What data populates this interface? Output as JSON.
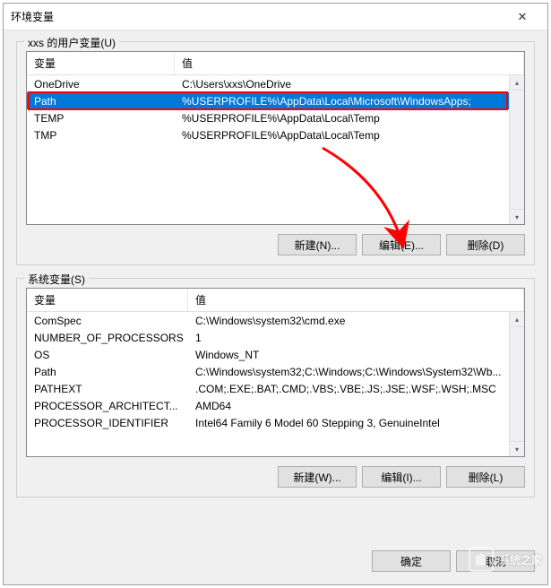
{
  "title": "环境变量",
  "userVars": {
    "label": "xxs 的用户变量(U)",
    "headers": {
      "name": "变量",
      "value": "值"
    },
    "rows": [
      {
        "name": "OneDrive",
        "value": "C:\\Users\\xxs\\OneDrive"
      },
      {
        "name": "Path",
        "value": "%USERPROFILE%\\AppData\\Local\\Microsoft\\WindowsApps;"
      },
      {
        "name": "TEMP",
        "value": "%USERPROFILE%\\AppData\\Local\\Temp"
      },
      {
        "name": "TMP",
        "value": "%USERPROFILE%\\AppData\\Local\\Temp"
      }
    ],
    "selectedIndex": 1,
    "buttons": {
      "new": "新建(N)...",
      "edit": "编辑(E)...",
      "delete": "删除(D)"
    }
  },
  "systemVars": {
    "label": "系统变量(S)",
    "headers": {
      "name": "变量",
      "value": "值"
    },
    "rows": [
      {
        "name": "ComSpec",
        "value": "C:\\Windows\\system32\\cmd.exe"
      },
      {
        "name": "NUMBER_OF_PROCESSORS",
        "value": "1"
      },
      {
        "name": "OS",
        "value": "Windows_NT"
      },
      {
        "name": "Path",
        "value": "C:\\Windows\\system32;C:\\Windows;C:\\Windows\\System32\\Wb..."
      },
      {
        "name": "PATHEXT",
        "value": ".COM;.EXE;.BAT;.CMD;.VBS;.VBE;.JS;.JSE;.WSF;.WSH;.MSC"
      },
      {
        "name": "PROCESSOR_ARCHITECT...",
        "value": "AMD64"
      },
      {
        "name": "PROCESSOR_IDENTIFIER",
        "value": "Intel64 Family 6 Model 60 Stepping 3, GenuineIntel"
      }
    ],
    "buttons": {
      "new": "新建(W)...",
      "edit": "编辑(I)...",
      "delete": "删除(L)"
    }
  },
  "dialog": {
    "ok": "确定",
    "cancel": "取消"
  },
  "watermark": "系统之家"
}
